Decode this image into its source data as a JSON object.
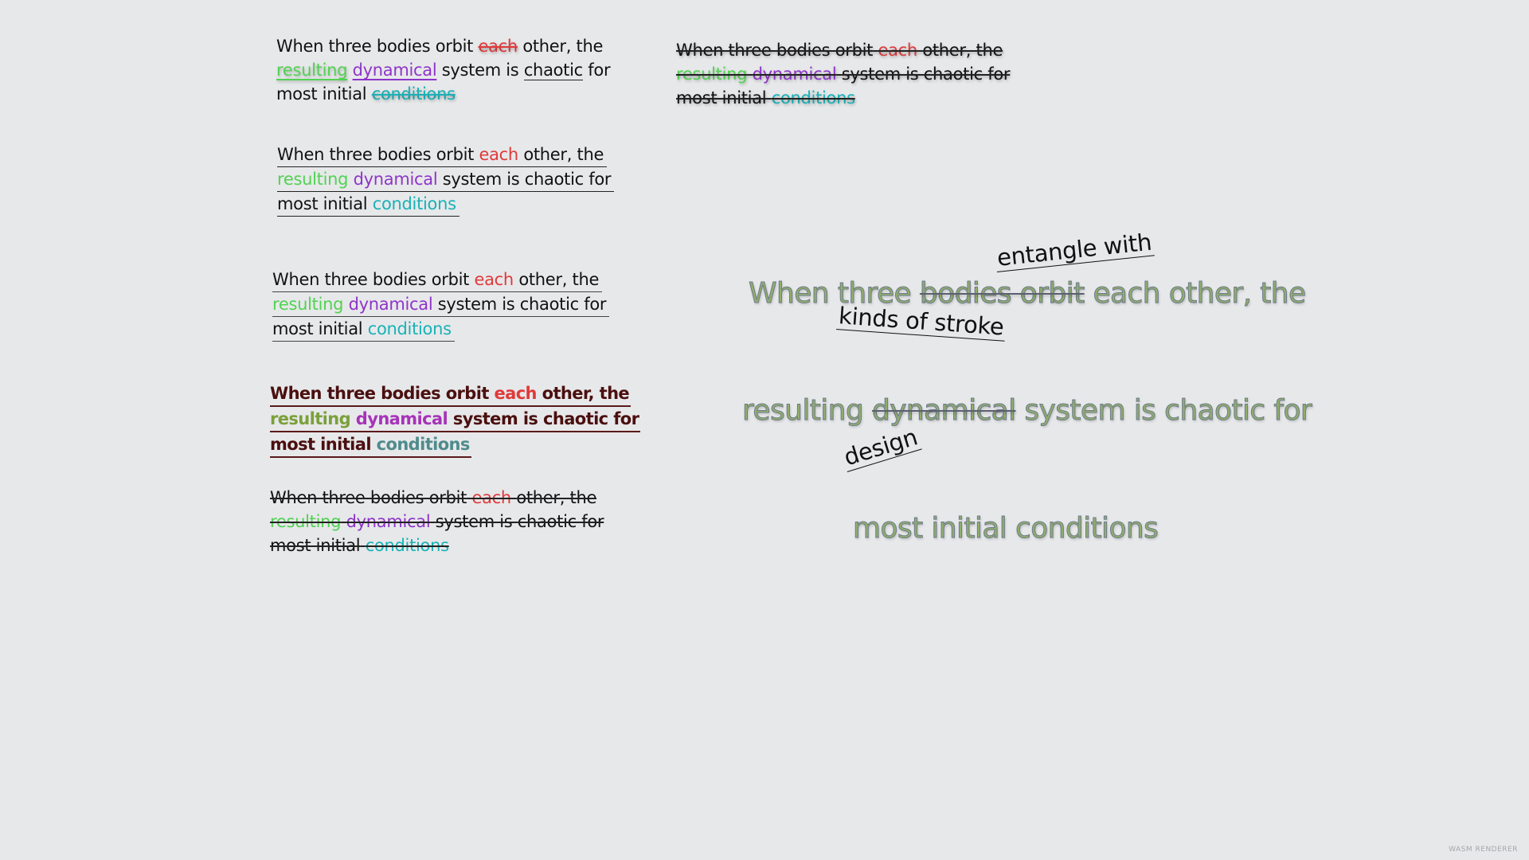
{
  "colors": {
    "background": "#e7e8ea",
    "red": "#e03a3a",
    "green": "#52d252",
    "purple": "#8e35c8",
    "teal": "#19b2b7",
    "dark_red": "#4a0f0f",
    "olive": "#7ba03a",
    "magenta": "#a633b8",
    "slate": "#4f8b8c",
    "big_fill": "#8fae6c"
  },
  "phrase": {
    "part1": "When three bodies orbit",
    "each": "each",
    "part2": "other, the",
    "resulting": "resulting",
    "dynamical": "dynamical",
    "system_is": "system is",
    "chaotic": "chaotic",
    "for": "for",
    "system_is_chaotic_for": "system is chaotic for",
    "most_initial": "most initial",
    "conditions": "conditions"
  },
  "big": {
    "line1_a": "When three",
    "line1_strike": "bodies orbit",
    "line1_b": "each other, the",
    "line2_a": "resulting",
    "line2_strike": "dynamical",
    "line2_b": "system is chaotic for",
    "line3": "most initial conditions"
  },
  "annotations": {
    "a1": "entangle with",
    "a2": "kinds of stroke",
    "a3": "design"
  },
  "watermark": "WASM RENDERER"
}
